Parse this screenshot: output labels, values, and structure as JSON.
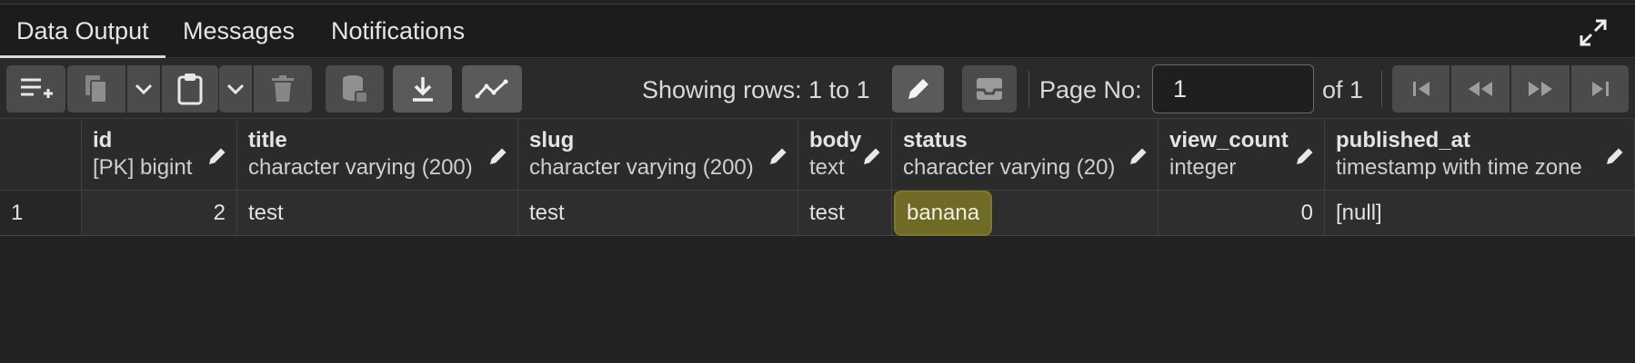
{
  "tabs": [
    {
      "label": "Data Output",
      "active": true
    },
    {
      "label": "Messages",
      "active": false
    },
    {
      "label": "Notifications",
      "active": false
    }
  ],
  "toolbar": {
    "rows_label": "Showing rows: 1 to 1",
    "page_label": "Page No:",
    "page_value": "1",
    "of_label": "of 1"
  },
  "columns": [
    {
      "name": "id",
      "type": "[PK] bigint"
    },
    {
      "name": "title",
      "type": "character varying (200)"
    },
    {
      "name": "slug",
      "type": "character varying (200)"
    },
    {
      "name": "body",
      "type": "text"
    },
    {
      "name": "status",
      "type": "character varying (20)"
    },
    {
      "name": "view_count",
      "type": "integer"
    },
    {
      "name": "published_at",
      "type": "timestamp with time zone"
    }
  ],
  "rows": [
    {
      "rownum": "1",
      "cells": [
        "2",
        "test",
        "test",
        "test",
        "banana",
        "0",
        "[null]"
      ]
    }
  ],
  "colors": {
    "background": "#232323",
    "toolbar_button": "#4b4b4b",
    "highlight": "#6f6a26"
  }
}
